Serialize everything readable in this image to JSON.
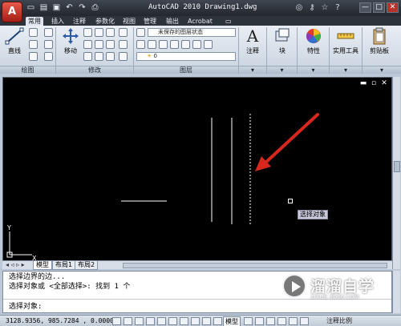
{
  "app": {
    "title": "AutoCAD 2010  Drawing1.dwg",
    "logo_letter": "A",
    "accent": "#c0271d"
  },
  "quick_access": [
    "new-icon",
    "open-icon",
    "save-icon",
    "undo-icon",
    "redo-icon",
    "plot-icon"
  ],
  "title_tools": [
    "binoculars-icon",
    "key-icon",
    "star-icon",
    "help-icon"
  ],
  "window_controls": {
    "minimize": "—",
    "maximize": "□",
    "close": "✕"
  },
  "ribbon_tabs": [
    {
      "label": "常用",
      "active": true
    },
    {
      "label": "插入",
      "active": false
    },
    {
      "label": "注释",
      "active": false
    },
    {
      "label": "参数化",
      "active": false
    },
    {
      "label": "视图",
      "active": false
    },
    {
      "label": "管理",
      "active": false
    },
    {
      "label": "输出",
      "active": false
    },
    {
      "label": "Acrobat",
      "active": false
    }
  ],
  "ribbon": {
    "line_label": "直线",
    "move_label": "移动",
    "layer_state": "未保存的图层状态",
    "layer_current": "0",
    "panels": {
      "draw": "绘图",
      "modify": "修改",
      "layers": "图层"
    },
    "annotation_label": "注释",
    "block_label": "块",
    "properties_label": "特性",
    "utilities_label": "实用工具",
    "clipboard_label": "剪贴板"
  },
  "viewport": {
    "tooltip": "选择对象",
    "restore": "▫",
    "maximize": "▭",
    "close": "✕",
    "axis_y": "Y",
    "axis_x": "X"
  },
  "layout_tabs": [
    {
      "label": "模型",
      "active": true
    },
    {
      "label": "布局1",
      "active": false
    },
    {
      "label": "布局2",
      "active": false
    }
  ],
  "command": {
    "history": [
      "选择边界的边...",
      "选择对象或 <全部选择>:  找到 1 个"
    ],
    "prompt": "选择对象:"
  },
  "status": {
    "coordinates": "3128.9356, 985.7284 , 0.0000",
    "model_label": "模型",
    "annotation_scale": "注释比例"
  },
  "watermark": {
    "name": "溜溜自学",
    "url": "ZIXUE.3D66.COM"
  },
  "colors": {
    "canvas": "#000000",
    "arrow": "#d8281e",
    "tooltip_bg": "#c9c9dc"
  }
}
